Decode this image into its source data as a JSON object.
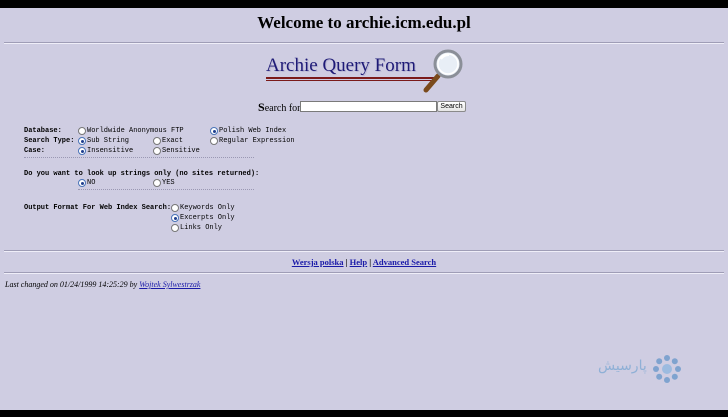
{
  "page": {
    "title": "Welcome to archie.icm.edu.pl",
    "logo_text": "Archie Query Form",
    "search_label_first": "S",
    "search_label_rest": "earch for:",
    "search_value": "",
    "search_button": "Search"
  },
  "form": {
    "database": {
      "label": "Database:",
      "options": [
        "Worldwide Anonymous FTP",
        "Polish Web Index"
      ],
      "selected": "Polish Web Index"
    },
    "search_type": {
      "label": "Search Type:",
      "options": [
        "Sub String",
        "Exact",
        "Regular Expression"
      ],
      "selected": "Sub String"
    },
    "case": {
      "label": "Case:",
      "options": [
        "Insensitive",
        "Sensitive"
      ],
      "selected": "Insensitive"
    },
    "strings_only": {
      "label": "Do you want to look up strings only (no sites returned):",
      "options": [
        "NO",
        "YES"
      ],
      "selected": "NO"
    },
    "output_format": {
      "label": "Output Format For Web Index Search:",
      "options": [
        "Keywords Only",
        "Excerpts Only",
        "Links Only"
      ],
      "selected": "Excerpts Only"
    }
  },
  "nav_links": {
    "polish": "Wersja polska",
    "sep1": "|",
    "help": "Help",
    "sep2": "|",
    "advanced": "Advanced Search"
  },
  "footer": {
    "prefix": "Last changed on 01/24/1999 14:25:29 by ",
    "author": "Wojtek Sylwestrzak"
  },
  "watermark": {
    "text": "پارسیش",
    "icon": "flower-logo-icon"
  },
  "colors": {
    "background": "#cfcde2",
    "link": "#1a1aa8",
    "logo_text": "#1e1a77",
    "watermark": "#8fb0d6"
  }
}
